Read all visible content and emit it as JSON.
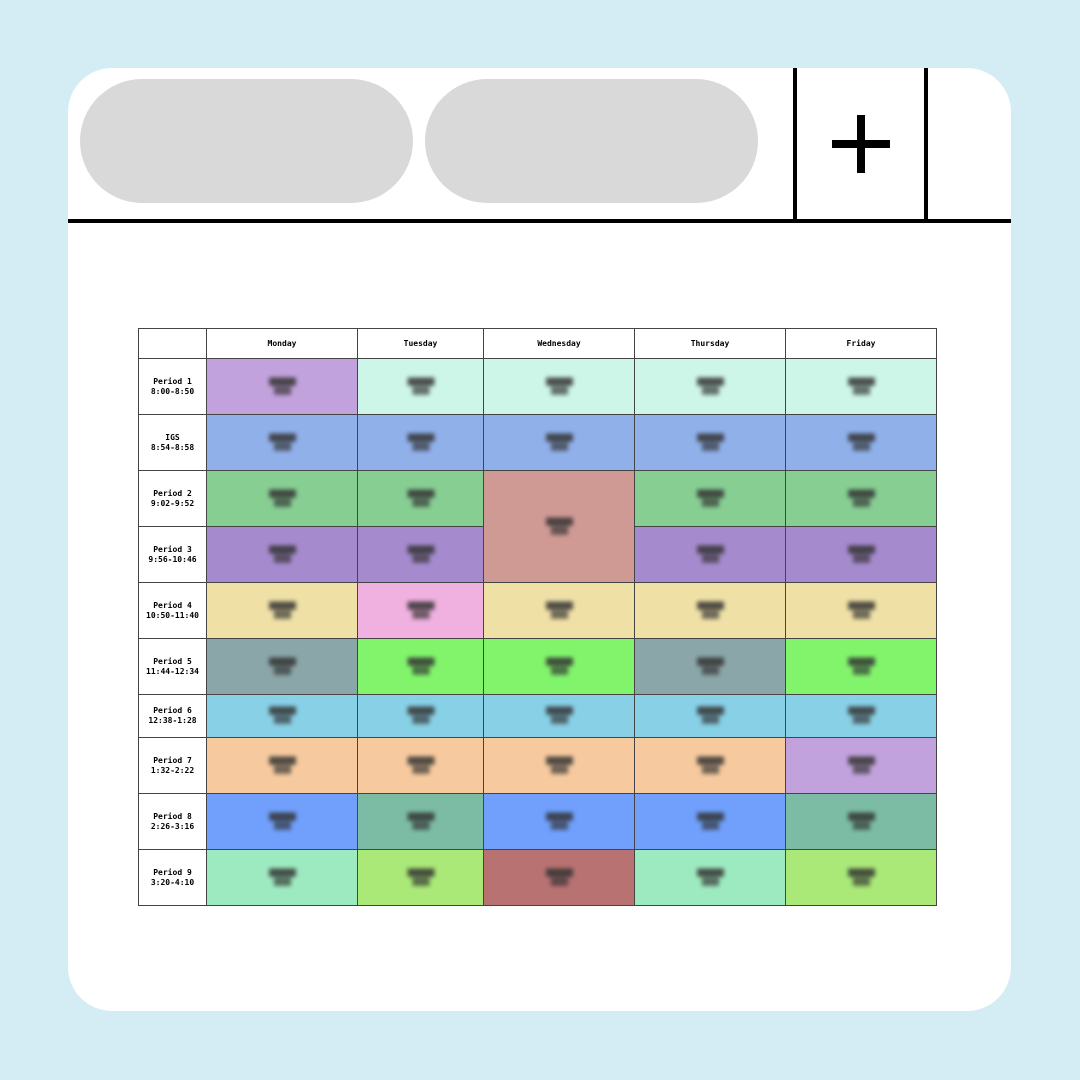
{
  "header": {
    "tabs": [
      {
        "label": ""
      },
      {
        "label": ""
      }
    ],
    "add_icon": "plus-icon"
  },
  "timetable": {
    "days": [
      "Monday",
      "Tuesday",
      "Wednesday",
      "Thursday",
      "Friday"
    ],
    "periods": [
      {
        "name": "Period 1",
        "time": "8:00-8:50"
      },
      {
        "name": "IGS",
        "time": "8:54-8:58"
      },
      {
        "name": "Period 2",
        "time": "9:02-9:52"
      },
      {
        "name": "Period 3",
        "time": "9:56-10:46"
      },
      {
        "name": "Period 4",
        "time": "10:50-11:40"
      },
      {
        "name": "Period 5",
        "time": "11:44-12:34"
      },
      {
        "name": "Period 6",
        "time": "12:38-1:28"
      },
      {
        "name": "Period 7",
        "time": "1:32-2:22"
      },
      {
        "name": "Period 8",
        "time": "2:26-3:16"
      },
      {
        "name": "Period 9",
        "time": "3:20-4:10"
      }
    ],
    "cell_colors": [
      [
        "#c2a2dc",
        "#cdf6e8",
        "#cdf6e8",
        "#cdf6e8",
        "#cdf6e8"
      ],
      [
        "#90b0ea",
        "#90b0ea",
        "#90b0ea",
        "#90b0ea",
        "#90b0ea"
      ],
      [
        "#87ce93",
        "#87ce93",
        "#d09a94",
        "#87ce93",
        "#87ce93"
      ],
      [
        "#a68ace",
        "#a68ace",
        null,
        "#a68ace",
        "#a68ace"
      ],
      [
        "#efe0a6",
        "#f0b0e0",
        "#efe0a6",
        "#efe0a6",
        "#efe0a6"
      ],
      [
        "#8aa6a9",
        "#82f46c",
        "#82f46c",
        "#8aa6a9",
        "#82f46c"
      ],
      [
        "#88d0e6",
        "#88d0e6",
        "#88d0e6",
        "#88d0e6",
        "#88d0e6"
      ],
      [
        "#f6ca9e",
        "#f6ca9e",
        "#f6ca9e",
        "#f6ca9e",
        "#c2a2dc"
      ],
      [
        "#70a0fc",
        "#7cbca4",
        "#70a0fc",
        "#70a0fc",
        "#7cbca4"
      ],
      [
        "#9eeac0",
        "#aae878",
        "#b87272",
        "#9eeac0",
        "#aae878"
      ]
    ]
  }
}
